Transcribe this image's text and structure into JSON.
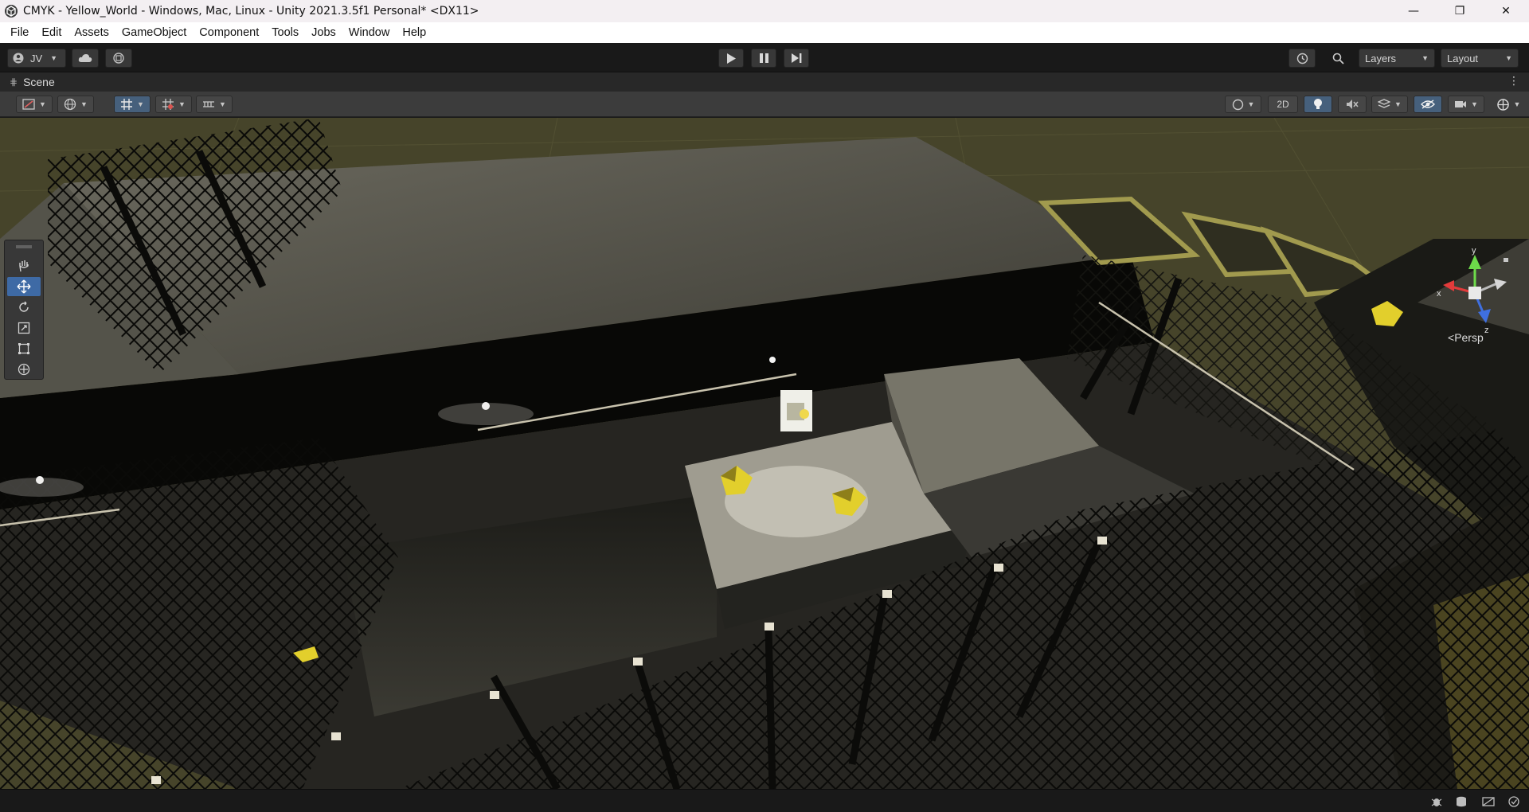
{
  "window": {
    "title": "CMYK - Yellow_World - Windows, Mac, Linux - Unity 2021.3.5f1 Personal* <DX11>",
    "minimize_glyph": "—",
    "restore_glyph": "❐",
    "close_glyph": "✕"
  },
  "menu": {
    "items": [
      "File",
      "Edit",
      "Assets",
      "GameObject",
      "Component",
      "Tools",
      "Jobs",
      "Window",
      "Help"
    ]
  },
  "toolbar": {
    "account_label": "JV",
    "layers_label": "Layers",
    "layout_label": "Layout"
  },
  "scene": {
    "tab_label": "Scene",
    "toggle_2d_label": "2D",
    "persp_label": "Persp",
    "axis_labels": {
      "x": "x",
      "y": "y",
      "z": "z"
    }
  },
  "colors": {
    "accent": "#3e6aa5",
    "ground": "#3d3b22",
    "crystal": "#e2cf2c",
    "fence": "#0c0c0a"
  },
  "icons": {
    "play": "play-icon",
    "pause": "pause-icon",
    "step": "step-icon",
    "history": "history-icon",
    "search": "search-icon",
    "cloud": "cloud-icon",
    "collab": "collab-icon"
  }
}
